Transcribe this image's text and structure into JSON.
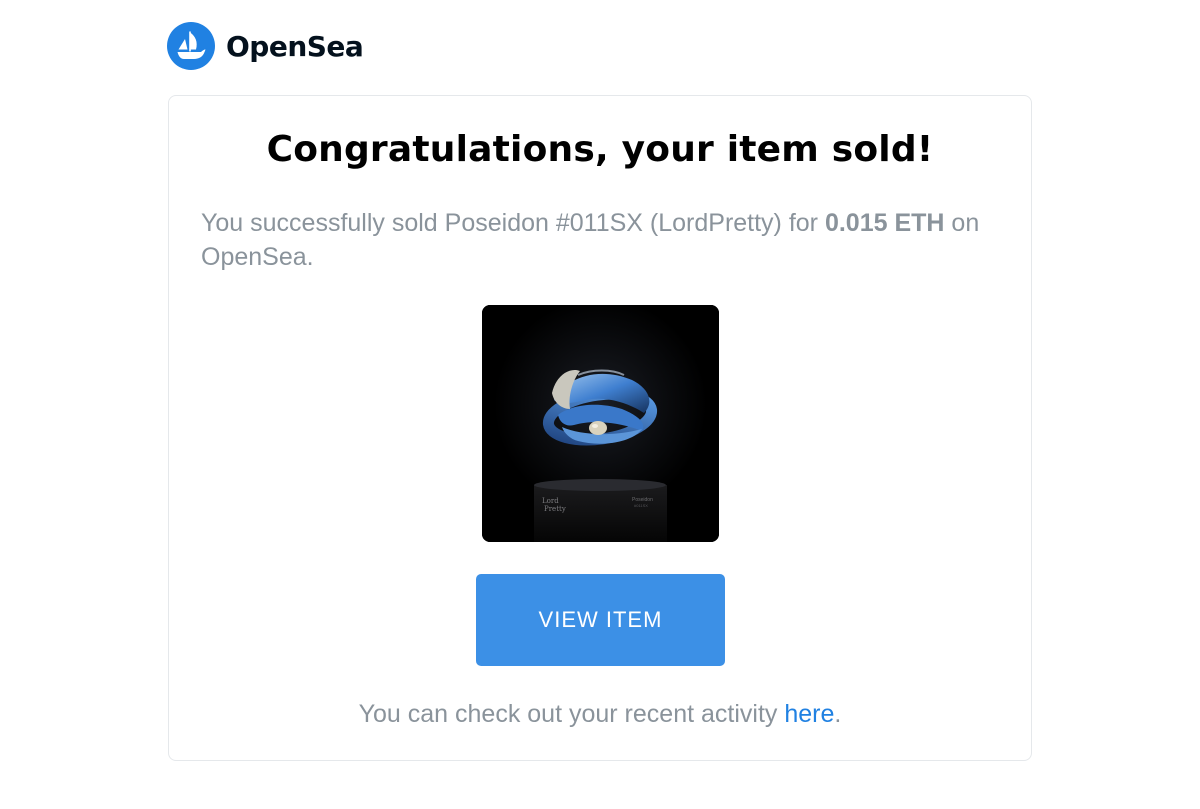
{
  "brand": {
    "name": "OpenSea",
    "logo_icon": "opensea-ship-icon",
    "logo_color": "#2081e2"
  },
  "email": {
    "headline": "Congratulations, your item sold!",
    "message_prefix": "You successfully sold Poseidon #011SX (LordPretty) for ",
    "amount": "0.015 ETH",
    "message_suffix": " on OpenSea.",
    "item_image_icon": "nft-ring-artwork",
    "button_label": "VIEW ITEM",
    "button_color": "#3c90e6",
    "footer_prefix": "You can check out your recent activity ",
    "footer_link": "here",
    "footer_suffix": "."
  },
  "colors": {
    "text_muted": "#8a939b",
    "link": "#2081e2",
    "headline": "#000000"
  }
}
